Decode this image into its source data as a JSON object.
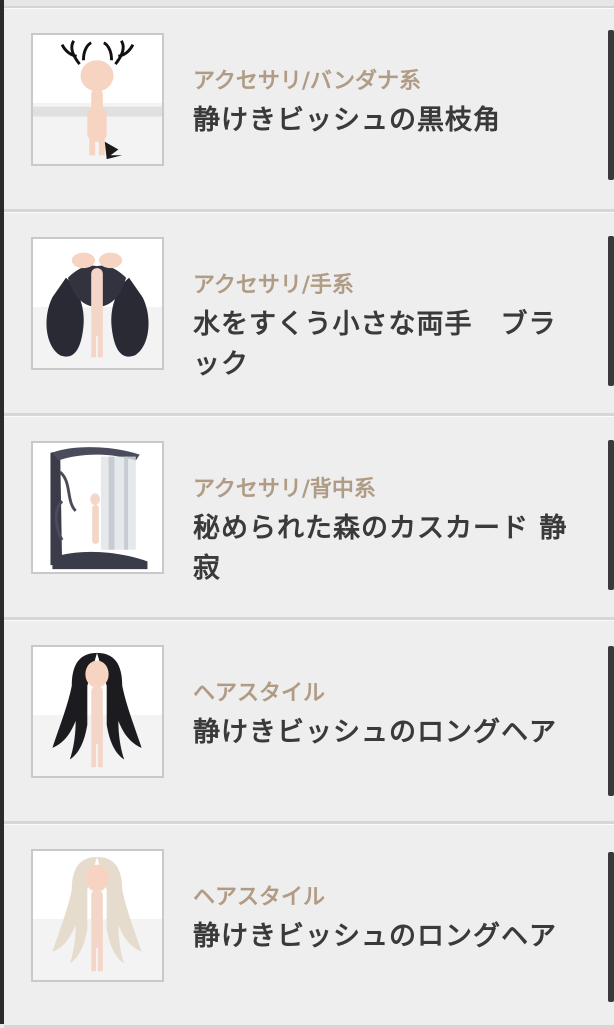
{
  "items": [
    {
      "category": "アクセサリ/バンダナ系",
      "name": "静けきビッシュの黒枝角",
      "thumbnail_icon": "antler-accessory-icon"
    },
    {
      "category": "アクセサリ/手系",
      "name": "水をすくう小さな両手　ブラック",
      "thumbnail_icon": "hands-accessory-icon"
    },
    {
      "category": "アクセサリ/背中系",
      "name": "秘められた森のカスカード 静寂",
      "thumbnail_icon": "forest-cascade-icon"
    },
    {
      "category": "ヘアスタイル",
      "name": "静けきビッシュのロングヘア",
      "thumbnail_icon": "long-hair-black-icon"
    },
    {
      "category": "ヘアスタイル",
      "name": "静けきビッシュのロングヘア",
      "thumbnail_icon": "long-hair-blonde-icon"
    }
  ],
  "colors": {
    "category_text": "#b09c85",
    "name_text": "#3a3a3a",
    "row_background": "#eeeeee",
    "divider": "#d6d6d6"
  }
}
